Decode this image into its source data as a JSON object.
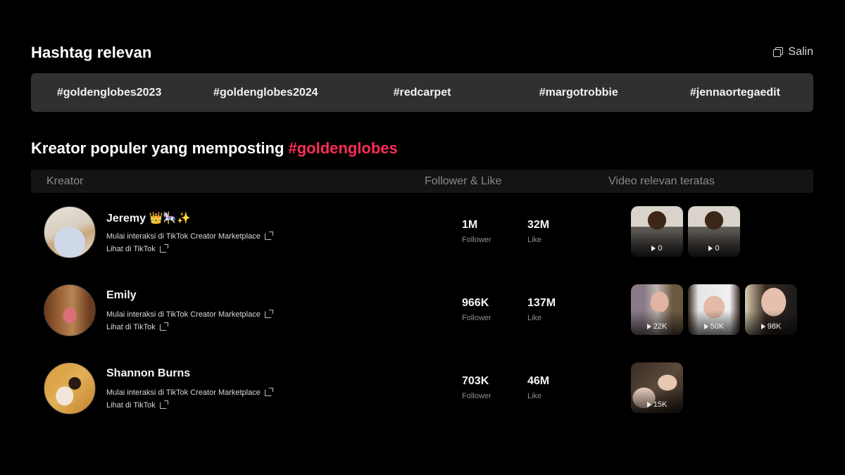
{
  "hashtags_section": {
    "title": "Hashtag relevan",
    "copy_label": "Salin",
    "copy_icon": "copy-icon",
    "items": [
      "#goldenglobes2023",
      "#goldenglobes2024",
      "#redcarpet",
      "#margotrobbie",
      "#jennaortegaedit"
    ]
  },
  "creators_section": {
    "title_prefix": "Kreator populer yang memposting ",
    "title_hashtag": "#goldenglobes",
    "accent_color": "#fe2c55",
    "columns": {
      "creator": "Kreator",
      "follower_like": "Follower & Like",
      "videos": "Video relevan teratas"
    },
    "creators": [
      {
        "name": "Jeremy 👑🎠✨",
        "marketplace_link": "Mulai interaksi di TikTok Creator Marketplace",
        "tiktok_link": "Lihat di TikTok",
        "followers": "1M",
        "followers_label": "Follower",
        "likes": "32M",
        "likes_label": "Like",
        "videos": [
          {
            "plays": "0"
          },
          {
            "plays": "0"
          }
        ]
      },
      {
        "name": "Emily",
        "marketplace_link": "Mulai interaksi di TikTok Creator Marketplace",
        "tiktok_link": "Lihat di TikTok",
        "followers": "966K",
        "followers_label": "Follower",
        "likes": "137M",
        "likes_label": "Like",
        "videos": [
          {
            "plays": "22K"
          },
          {
            "plays": "50K"
          },
          {
            "plays": "98K"
          }
        ]
      },
      {
        "name": "Shannon Burns",
        "marketplace_link": "Mulai interaksi di TikTok Creator Marketplace",
        "tiktok_link": "Lihat di TikTok",
        "followers": "703K",
        "followers_label": "Follower",
        "likes": "46M",
        "likes_label": "Like",
        "videos": [
          {
            "plays": "15K"
          }
        ]
      }
    ]
  }
}
